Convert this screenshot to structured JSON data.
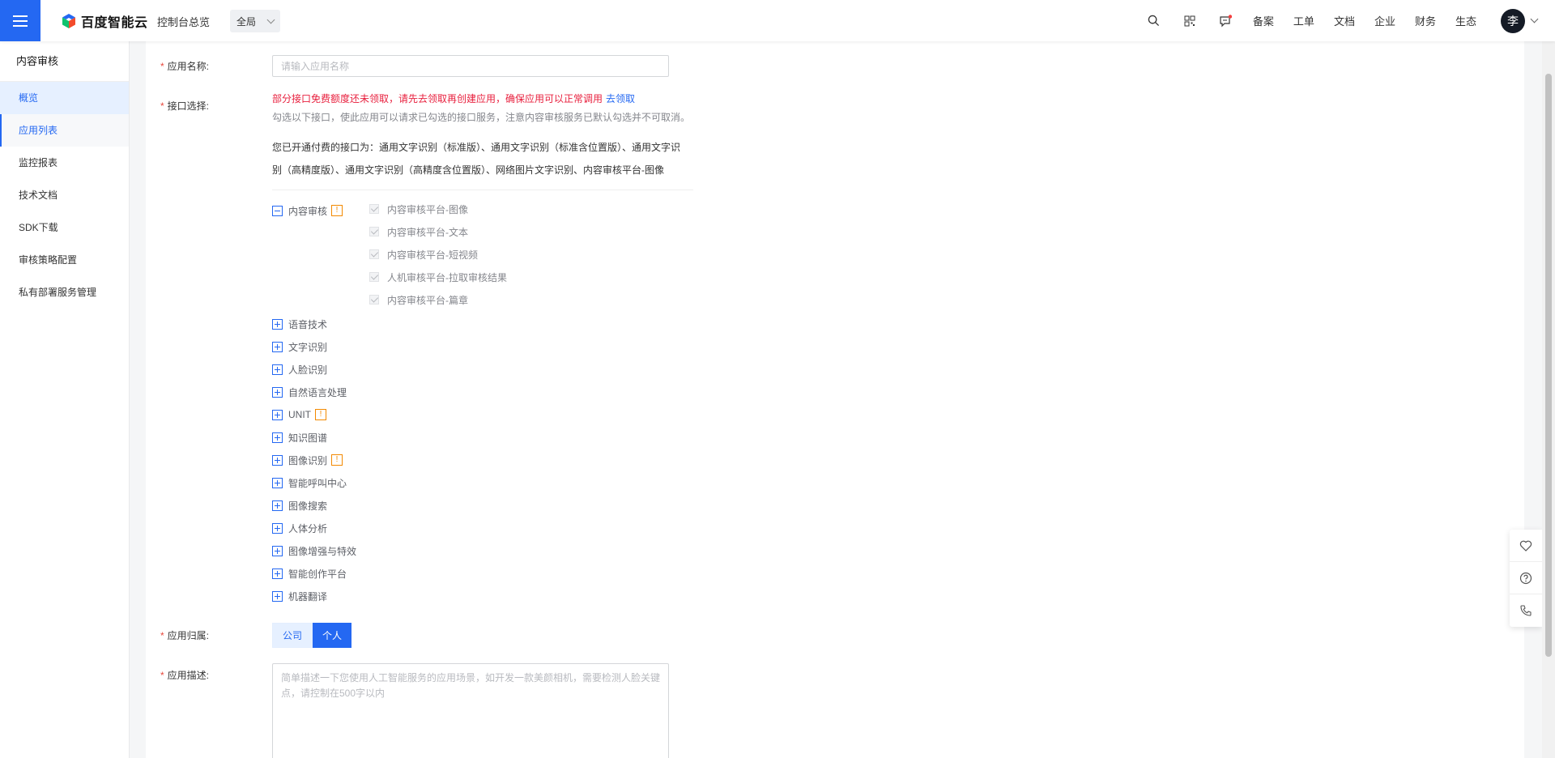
{
  "topbar": {
    "brand": "百度智能云",
    "console_link": "控制台总览",
    "region": "全局",
    "nav": [
      "备案",
      "工单",
      "文档",
      "企业",
      "财务",
      "生态"
    ],
    "avatar_text": "李",
    "icons": [
      "search-icon",
      "qrcode-icon",
      "message-icon"
    ]
  },
  "sidebar": {
    "title": "内容审核",
    "items": [
      {
        "label": "概览"
      },
      {
        "label": "应用列表"
      },
      {
        "label": "监控报表"
      },
      {
        "label": "技术文档"
      },
      {
        "label": "SDK下载"
      },
      {
        "label": "审核策略配置"
      },
      {
        "label": "私有部署服务管理"
      }
    ]
  },
  "form": {
    "app_name": {
      "label": "应用名称:",
      "placeholder": "请输入应用名称",
      "value": ""
    },
    "api_select": {
      "label": "接口选择:",
      "warning": "部分接口免费额度还未领取，请先去领取再创建应用，确保应用可以正常调用",
      "warning_link": "去领取",
      "hint": "勾选以下接口，使此应用可以请求已勾选的接口服务，注意内容审核服务已默认勾选并不可取消。",
      "paid_line1": "您已开通付费的接口为：通用文字识别（标准版）、通用文字识别（标准含位置版）、通用文字识",
      "paid_line2": "别（高精度版）、通用文字识别（高精度含位置版）、网络图片文字识别、内容审核平台-图像",
      "groups": [
        {
          "label": "内容审核",
          "expanded": true,
          "badge": "!"
        },
        {
          "label": "语音技术"
        },
        {
          "label": "文字识别"
        },
        {
          "label": "人脸识别"
        },
        {
          "label": "自然语言处理"
        },
        {
          "label": "UNIT",
          "badge": "!"
        },
        {
          "label": "知识图谱"
        },
        {
          "label": "图像识别",
          "badge": "!"
        },
        {
          "label": "智能呼叫中心"
        },
        {
          "label": "图像搜索"
        },
        {
          "label": "人体分析"
        },
        {
          "label": "图像增强与特效"
        },
        {
          "label": "智能创作平台"
        },
        {
          "label": "机器翻译"
        }
      ],
      "content_audit_items": [
        {
          "label": "内容审核平台-图像",
          "checked": true
        },
        {
          "label": "内容审核平台-文本",
          "checked": true
        },
        {
          "label": "内容审核平台-短视频",
          "checked": true
        },
        {
          "label": "人机审核平台-拉取审核结果",
          "checked": true
        },
        {
          "label": "内容审核平台-篇章",
          "checked": true
        }
      ]
    },
    "ownership": {
      "label": "应用归属:",
      "options": [
        "公司",
        "个人"
      ],
      "selected": "个人"
    },
    "description": {
      "label": "应用描述:",
      "placeholder": "简单描述一下您使用人工智能服务的应用场景，如开发一款美颜相机，需要检测人脸关键点，请控制在500字以内",
      "value": ""
    }
  },
  "float_panel": {
    "icons": [
      "favorite-icon",
      "help-icon",
      "phone-icon"
    ]
  },
  "colors": {
    "primary": "#2468f2",
    "warning": "#e8203e",
    "badge": "#f38900"
  }
}
